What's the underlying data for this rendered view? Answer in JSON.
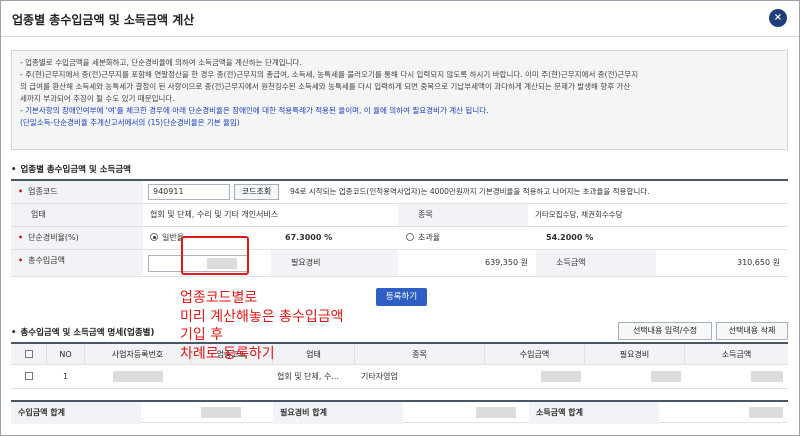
{
  "window": {
    "title": "업종별 총수입금액 및 소득금액 계산",
    "close_icon": "×"
  },
  "notice": {
    "lines": [
      "- 업종별로 수입금액을 세분화하고, 단순경비율에 의하여 소득금액을 계산하는 단계입니다.",
      "- 주(현)근무지에서 종(전)근무지를 포함해 연말정산을 한 경우 종(전)근무지의 총급여, 소득세, 농특세를 불러오기를 통해 다시 입력되지 않도록 하시기 바랍니다. 이미 주(현)근무지에서 종(전)근무지",
      "  의 급여를 환산해 소득세와 농특세가 결정이 된 사항이므로 종(전)근무지에서 원천징수된 소득세와 농특세를 다시 입력하게 되면 중복으로 기납부세액이 과다하게 계산되는 문제가 발생해 향후 가산",
      "  세까지 부과되어 추징이 될 수도 있기 때문입니다."
    ],
    "blue_lines": [
      "- 기본사항의 장애인여부에 '여'를 체크한 경우에 아래 단순경비율은 장애인에 대한 적용특례가 적용된 율이며, 이 율에 의하여 필요경비가 계산 됩니다.",
      "  (단일소득-단순경비율 추계신고서에서의 (15)단순경비율은 기본 율임)"
    ]
  },
  "section1": {
    "title": "업종별 총수입금액 및 소득금액",
    "industry_code_label": "업종코드",
    "industry_code_value": "940911",
    "code_lookup_button": "코드조회",
    "code_hint": "94로 시작되는 업종코드(인적용역사업자)는 4000만원까지 기본경비율을 적용하고 나머지는 초과율을 적용합니다.",
    "business_type_label": "업태",
    "business_type_value": "협회 및 단체, 수리 및 기타 개인서비스",
    "item_label": "종목",
    "item_value": "기타모집수당, 채권회수수당",
    "rate_label": "단순경비율(%)",
    "general_rate_label": "일반율",
    "general_rate_value": "67.3000 %",
    "excess_rate_label": "초과율",
    "excess_rate_value": "54.2000 %",
    "total_income_label": "총수입금액",
    "total_income_value": "",
    "necessary_expense_label": "필요경비",
    "necessary_expense_value": "639,350",
    "income_amount_label": "소득금액",
    "income_amount_value": "310,650",
    "won_unit": "원",
    "register_button": "등록하기"
  },
  "section2": {
    "title": "총수입금액 및 소득금액 명세(업종별)",
    "edit_button": "선택내용 입력/수정",
    "delete_button": "선택내용 삭제",
    "columns": [
      "NO",
      "사업자등록번호",
      "업종코드",
      "업태",
      "종목",
      "수입금액",
      "필요경비",
      "소득금액"
    ],
    "rows": [
      {
        "no": "1",
        "business_type": "협회 및 단체, 수...",
        "item": "기타자영업"
      }
    ],
    "totals": {
      "income_total_label": "수입금액 합계",
      "expense_total_label": "필요경비 합계",
      "income_amount_total_label": "소득금액 합계"
    }
  },
  "annotation": {
    "lines": [
      "업종코드별로",
      "미리 계산해놓은 총수입금액",
      "기입 후",
      "차례로 등록하기"
    ],
    "color": "#e01818"
  }
}
